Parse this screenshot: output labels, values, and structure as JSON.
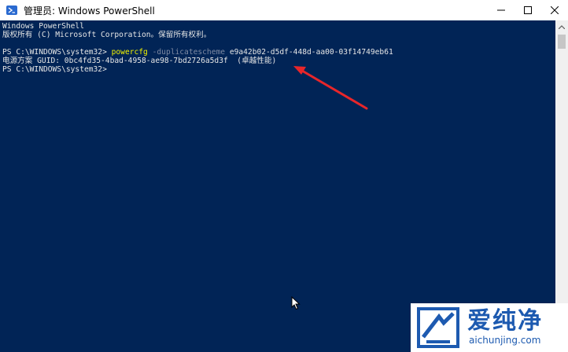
{
  "window": {
    "title": "管理员: Windows PowerShell",
    "icon": "powershell-icon",
    "controls": [
      "minimize-icon",
      "maximize-icon",
      "close-icon"
    ]
  },
  "console": {
    "line1": "Windows PowerShell",
    "line2": "版权所有 (C) Microsoft Corporation。保留所有权利。",
    "prompt1": "PS C:\\WINDOWS\\system32> ",
    "cmd_name": "powercfg",
    "cmd_flag": " -duplicatescheme",
    "cmd_arg": " e9a42b02-d5df-448d-aa00-03f14749eb61",
    "result": "电源方案 GUID: 0bc4fd35-4bad-4958-ae98-7bd2726a5d3f  (卓越性能)",
    "prompt2": "PS C:\\WINDOWS\\system32>"
  },
  "colors": {
    "console_bg": "#012456",
    "annotation_arrow": "#e8262a",
    "watermark_blue": "#1d5ab0"
  },
  "watermark": {
    "cn": "爱纯净",
    "en": "aichunjing.com"
  }
}
